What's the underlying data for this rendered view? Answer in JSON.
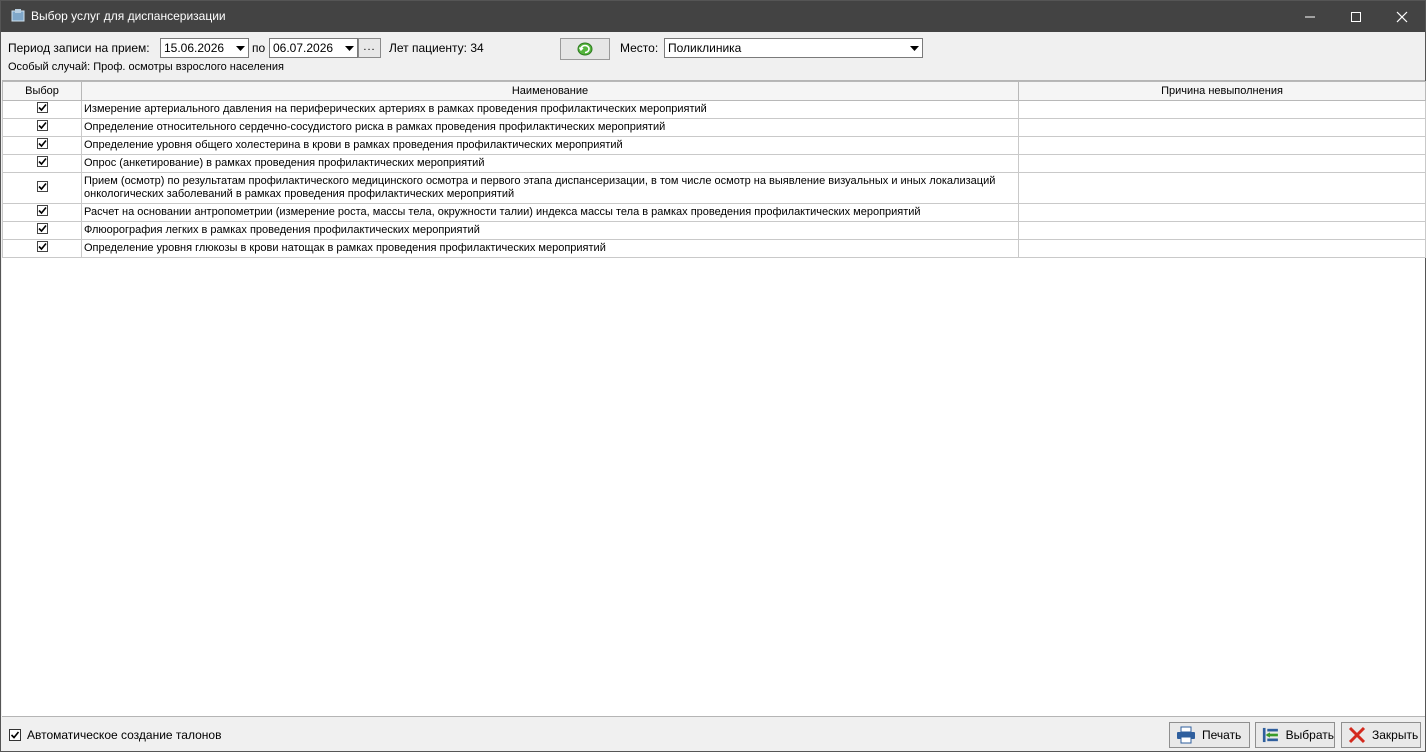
{
  "window": {
    "title": "Выбор услуг для диспансеризации"
  },
  "filters": {
    "period_label": "Период записи на прием:",
    "date_from": "15.06.2026",
    "to_label": "по",
    "date_to": "06.07.2026",
    "dots_label": "...",
    "age_label": "Лет пациенту: 34",
    "place_label": "Место:",
    "place_value": "Поликлиника",
    "special_case": "Особый случай: Проф. осмотры взрослого населения"
  },
  "table": {
    "headers": [
      "Выбор",
      "Наименование",
      "Причина невыполнения"
    ],
    "rows": [
      {
        "checked": true,
        "name": "Измерение артериального давления на периферических артериях в рамках проведения профилактических мероприятий",
        "reason": ""
      },
      {
        "checked": true,
        "name": "Определение относительного сердечно-сосудистого риска в рамках проведения профилактических мероприятий",
        "reason": ""
      },
      {
        "checked": true,
        "name": "Определение уровня общего холестерина в крови в рамках проведения профилактических мероприятий",
        "reason": ""
      },
      {
        "checked": true,
        "name": "Опрос (анкетирование) в рамках проведения профилактических мероприятий",
        "reason": ""
      },
      {
        "checked": true,
        "name": "Прием (осмотр) по результатам профилактического медицинского осмотра и первого этапа диспансеризации, в том числе осмотр на выявление визуальных и иных локализаций онкологических заболеваний в рамках проведения профилактических мероприятий",
        "reason": ""
      },
      {
        "checked": true,
        "name": "Расчет на основании антропометрии (измерение роста, массы тела, окружности талии) индекса массы тела в рамках проведения профилактических мероприятий",
        "reason": ""
      },
      {
        "checked": true,
        "name": "Флюорография легких в рамках проведения профилактических мероприятий",
        "reason": ""
      },
      {
        "checked": true,
        "name": "Определение уровня глюкозы в крови натощак в рамках проведения профилактических мероприятий",
        "reason": ""
      }
    ]
  },
  "footer": {
    "auto_label": "Автоматическое создание талонов",
    "auto_checked": true,
    "print_label": "Печать",
    "select_label": "Выбрать",
    "close_label": "Закрыть"
  },
  "colors": {
    "titlebar": "#434343",
    "accent_green": "#3a9a2a",
    "close_red": "#d42a1e",
    "print_blue": "#2f5f9e"
  }
}
